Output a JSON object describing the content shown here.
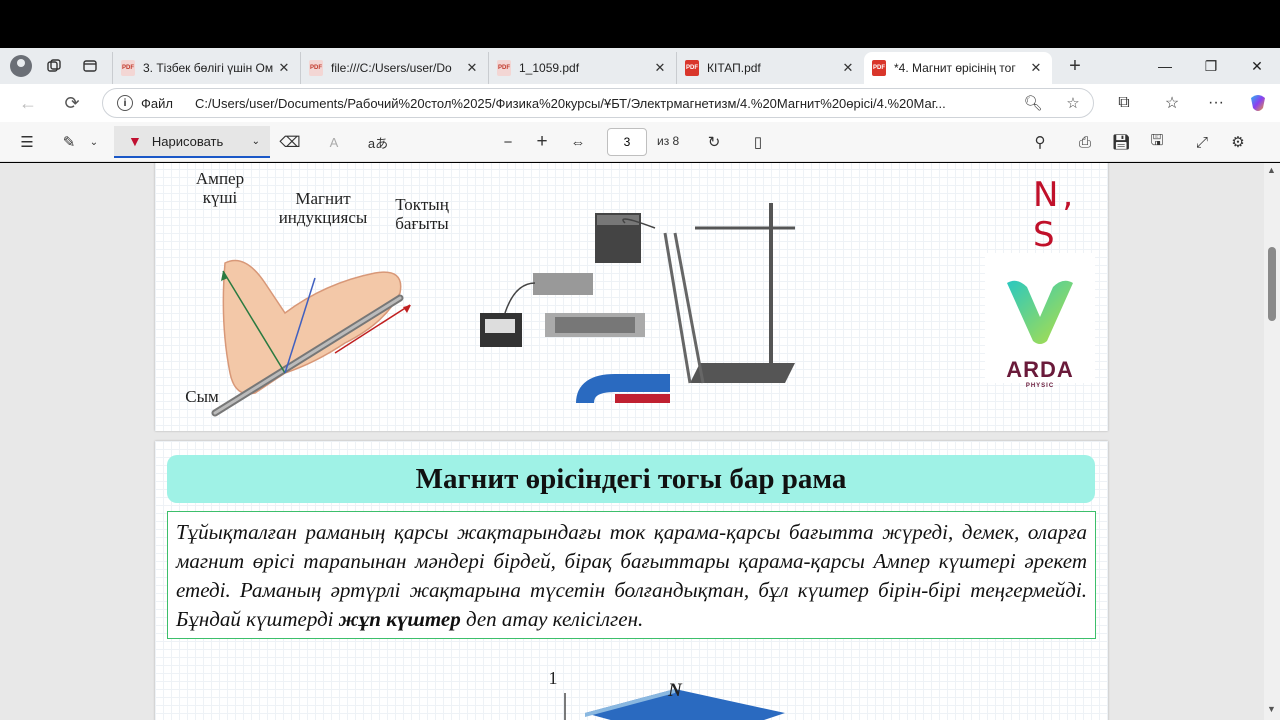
{
  "tabs": [
    {
      "title": "3. Тізбек бөлігі үшін Ом",
      "faded": true
    },
    {
      "title": "file:///C:/Users/user/Do",
      "faded": true
    },
    {
      "title": "1_1059.pdf",
      "faded": true
    },
    {
      "title": "КІТАП.pdf",
      "faded": false
    },
    {
      "title": "*4. Магнит өрісінің тог",
      "faded": false,
      "active": true
    }
  ],
  "address": {
    "label": "Файл",
    "url": "C:/Users/user/Documents/Рабочий%20стол%2025/Физика%20курсы/ҰБТ/Электрмагнетизм/4.%20Магнит%20өрісі/4.%20Маг..."
  },
  "pdf_toolbar": {
    "draw_label": "Нарисовать",
    "page_number": "3",
    "page_total": "из 8"
  },
  "figure1": {
    "ampere_force": "Ампер\nкүші",
    "induction": "Магнит\nиндукциясы",
    "current_dir": "Токтың\nбағыты",
    "wire": "Сым"
  },
  "annotation": "N, S",
  "logo": {
    "name": "ARDA",
    "sub": "PHYSIC"
  },
  "section": {
    "heading": "Магнит өрісіндегі тогы бар рама",
    "para_part1": "Тұйықталған раманың қарсы жақтарындағы ток қарама-қарсы бағытта жүреді, демек, оларға магнит өрісі тарапынан мәндері бірдей, бірақ бағыттары қарама-қарсы Ампер күштері әрекет етеді. Раманың әртүрлі жақтарына түсетін болғандықтан, бұл күштер бірін-бірі теңгермейді. Бұндай күштерді ",
    "para_bold": "жұп күштер",
    "para_part2": " деп атау келісілген."
  },
  "figure2": {
    "label_1": "1",
    "label_N": "N"
  },
  "colors": {
    "accent": "#1a57c7",
    "heading_bg": "#9ff2e6",
    "box_border": "#3cbf6b",
    "ink": "#c0102a"
  }
}
